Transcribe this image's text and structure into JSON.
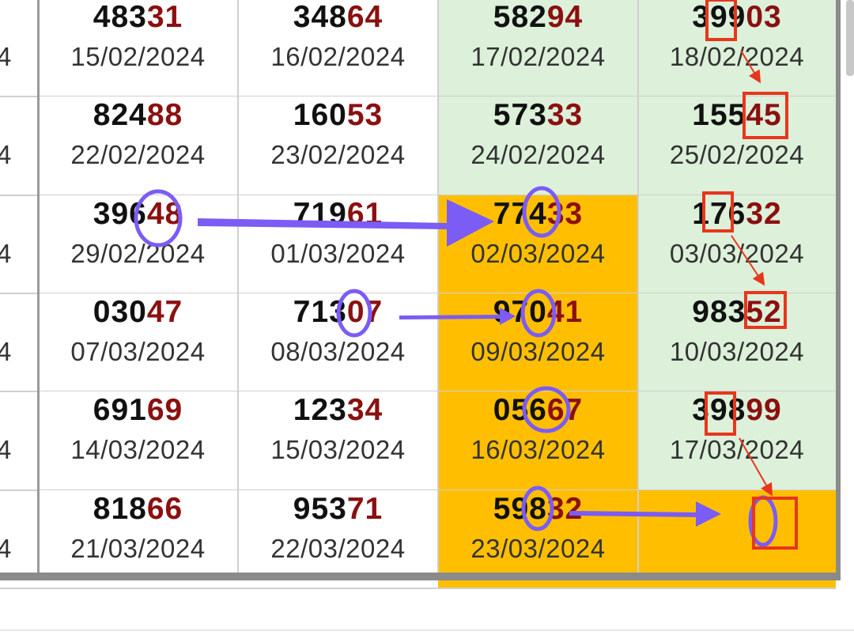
{
  "rows": [
    {
      "left_digit": "4",
      "cells": [
        {
          "lead": "483",
          "tail": "31",
          "date": "15/02/2024",
          "color": "white"
        },
        {
          "lead": "348",
          "tail": "64",
          "date": "16/02/2024",
          "color": "white"
        },
        {
          "lead": "582",
          "tail": "94",
          "date": "17/02/2024",
          "color": "green"
        },
        {
          "lead": "399",
          "tail": "03",
          "date": "18/02/2024",
          "color": "green"
        }
      ]
    },
    {
      "left_digit": "4",
      "cells": [
        {
          "lead": "824",
          "tail": "88",
          "date": "22/02/2024",
          "color": "white"
        },
        {
          "lead": "160",
          "tail": "53",
          "date": "23/02/2024",
          "color": "white"
        },
        {
          "lead": "573",
          "tail": "33",
          "date": "24/02/2024",
          "color": "green"
        },
        {
          "lead": "155",
          "tail": "45",
          "date": "25/02/2024",
          "color": "green"
        }
      ]
    },
    {
      "left_digit": "4",
      "cells": [
        {
          "lead": "396",
          "tail": "48",
          "date": "29/02/2024",
          "color": "white"
        },
        {
          "lead": "719",
          "tail": "61",
          "date": "01/03/2024",
          "color": "white"
        },
        {
          "lead": "774",
          "tail": "33",
          "date": "02/03/2024",
          "color": "orange"
        },
        {
          "lead": "176",
          "tail": "32",
          "date": "03/03/2024",
          "color": "green"
        }
      ]
    },
    {
      "left_digit": "4",
      "cells": [
        {
          "lead": "030",
          "tail": "47",
          "date": "07/03/2024",
          "color": "white"
        },
        {
          "lead": "713",
          "tail": "07",
          "date": "08/03/2024",
          "color": "white"
        },
        {
          "lead": "970",
          "tail": "41",
          "date": "09/03/2024",
          "color": "orange"
        },
        {
          "lead": "983",
          "tail": "52",
          "date": "10/03/2024",
          "color": "green"
        }
      ]
    },
    {
      "left_digit": "4",
      "cells": [
        {
          "lead": "691",
          "tail": "69",
          "date": "14/03/2024",
          "color": "white"
        },
        {
          "lead": "123",
          "tail": "34",
          "date": "15/03/2024",
          "color": "white"
        },
        {
          "lead": "056",
          "tail": "67",
          "date": "16/03/2024",
          "color": "orange"
        },
        {
          "lead": "398",
          "tail": "99",
          "date": "17/03/2024",
          "color": "green"
        }
      ]
    },
    {
      "left_digit": "4",
      "cells": [
        {
          "lead": "818",
          "tail": "66",
          "date": "21/03/2024",
          "color": "white"
        },
        {
          "lead": "953",
          "tail": "71",
          "date": "22/03/2024",
          "color": "white"
        },
        {
          "lead": "598",
          "tail": "32",
          "date": "23/03/2024",
          "color": "orange"
        },
        {
          "lead": "",
          "tail": "",
          "date": "",
          "color": "orange"
        }
      ]
    }
  ],
  "colors": {
    "white": "#ffffff",
    "green": "#dcf0da",
    "orange": "#ffbf00",
    "tail_red": "#8b1010",
    "annotation_purple": "#7b5cf5",
    "annotation_red": "#e8361c"
  }
}
